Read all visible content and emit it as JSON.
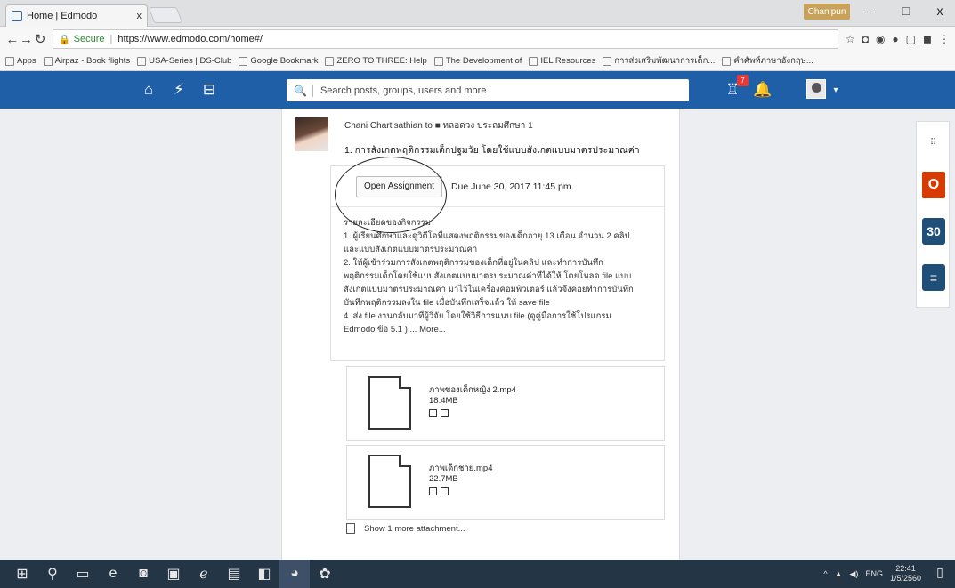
{
  "browser": {
    "tab_title": "Home | Edmodo",
    "tab_close": "x",
    "user_chip": "Chanipun",
    "win_min": "–",
    "win_max": "□",
    "win_close": "x",
    "url_secure": "Secure",
    "url": "https://www.edmodo.com/home#/",
    "bookmarks": [
      "Apps",
      "Airpaz - Book flights",
      "USA-Series | DS-Club",
      "Google Bookmark",
      "ZERO TO THREE: Help",
      "The Development of",
      "IEL Resources",
      "การส่งเสริมพัฒนาการเด็ก...",
      "คำศัพท์ภาษาอังกฤษ..."
    ]
  },
  "edmodo": {
    "search_placeholder": "Search posts, groups, users and more",
    "notification_count": "7"
  },
  "post": {
    "author": "Chani Chartisathian to ■ หลอดวง ประถมศึกษา 1",
    "title": "1. การสังเกตพฤติกรรมเด็กปฐมวัย โดยใช้แบบสังเกตแบบมาตรประมาณค่า",
    "open_assignment": "Open Assignment",
    "due": "Due June 30, 2017 11:45 pm",
    "body_lines": [
      "รายละเอียดของกิจกรรม",
      "1. ผู้เรียนศึกษาและดูวิดีโอที่แสดงพฤติกรรมของเด็กอายุ 13 เดือน จำนวน 2 คลิป",
      "และแบบสังเกตแบบมาตรประมาณค่า",
      "2. ให้ผู้เข้าร่วมการสังเกตพฤติกรรมของเด็กที่อยู่ในคลิป และทำการบันทึก",
      "พฤติกรรมเด็กโดยใช้แบบสังเกตแบบมาตรประมาณค่าที่ได้ให้ โดยโหลด file แบบ",
      "สังเกตแบบมาตรประมาณค่า มาไว้ในเครื่องคอมพิวเตอร์ แล้วจึงค่อยทำการบันทึก",
      "บันทึกพฤติกรรมลงใน file เมื่อบันทึกเสร็จแล้ว ให้ save file",
      "4. ส่ง file งานกลับมาที่ผู้วิจัย โดยใช้วิธีการแนบ file (ดูคู่มือการใช้โปรแกรม"
    ],
    "last_line": "Edmodo ข้อ 5.1 ) ...",
    "more_label": "More...",
    "files": [
      {
        "name": "ภาพของเด็กหญิง 2.mp4",
        "size": "18.4MB"
      },
      {
        "name": "ภาพเด็กชาย.mp4",
        "size": "22.7MB"
      }
    ],
    "show_more": "Show 1 more attachment..."
  },
  "rail": {
    "grid_glyph": "⠿",
    "office_glyph": "O",
    "calendar_day": "30",
    "quiz_glyph": "≡"
  },
  "taskbar": {
    "time": "22:41",
    "date": "1/5/2560",
    "lang": "ENG"
  }
}
